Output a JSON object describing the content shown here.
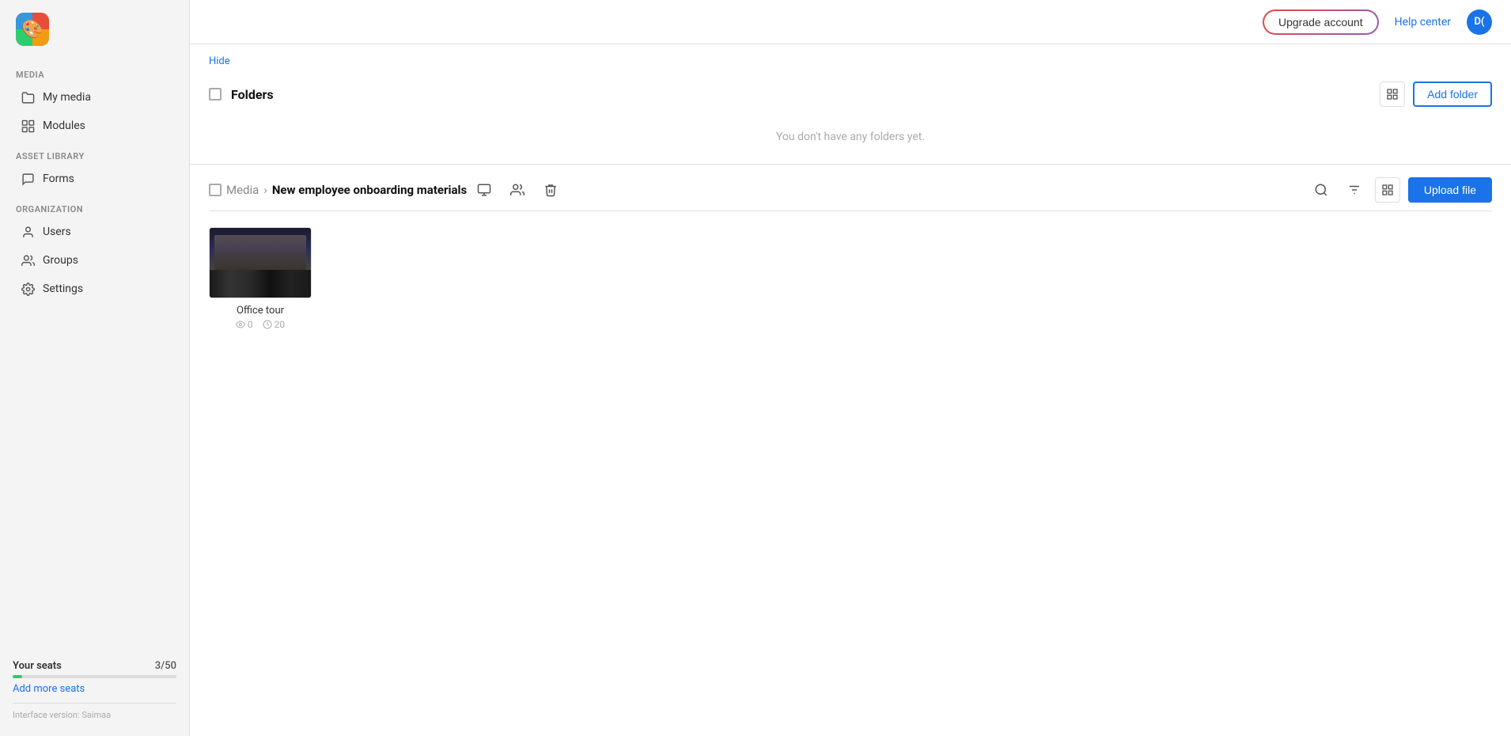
{
  "sidebar": {
    "media_section_label": "Media",
    "my_media_label": "My media",
    "modules_label": "Modules",
    "asset_library_label": "Asset library",
    "forms_label": "Forms",
    "organization_label": "Organization",
    "users_label": "Users",
    "groups_label": "Groups",
    "settings_label": "Settings",
    "seats_label": "Your seats",
    "seats_count": "3/50",
    "seats_used": 3,
    "seats_total": 50,
    "add_more_seats": "Add more seats",
    "interface_version": "Interface version: Saimaa"
  },
  "topbar": {
    "upgrade_label": "Upgrade account",
    "help_center_label": "Help center",
    "user_initials": "D("
  },
  "folders": {
    "hide_label": "Hide",
    "title": "Folders",
    "empty_message": "You don't have any folders yet.",
    "add_folder_label": "Add folder"
  },
  "media_section": {
    "breadcrumb_media": "Media",
    "breadcrumb_arrow": "›",
    "breadcrumb_current": "New employee onboarding materials",
    "upload_label": "Upload file",
    "files": [
      {
        "name": "Office tour",
        "views": "0",
        "completions": "20"
      }
    ]
  }
}
